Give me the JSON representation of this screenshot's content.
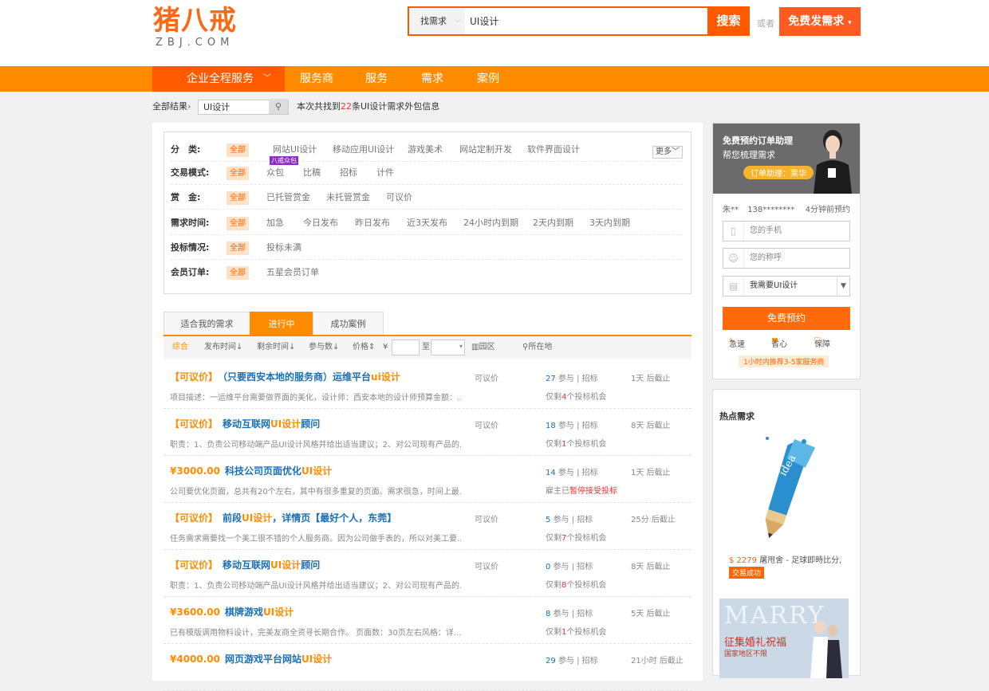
{
  "header": {
    "logo_cn": "猪八戒",
    "logo_en": "ZBJ.COM",
    "search_type": "找需求",
    "search_value": "UI设计",
    "search_btn": "搜索",
    "or": "或者",
    "post_btn": "免费发需求",
    "brand_color": "#ff5a00"
  },
  "nav": {
    "all_services": "企业全程服务",
    "items": [
      "服务商",
      "服务",
      "需求",
      "案例"
    ]
  },
  "crumb": {
    "all": "全部结果",
    "keyword": "UI设计",
    "found_pre": "本次共找到",
    "found_num": "22",
    "found_post": "条UI设计需求外包信息"
  },
  "filters": {
    "all_label": "全部",
    "more": "更多",
    "badge": "八戒众包",
    "rows": [
      {
        "label": "分　类:",
        "options": [
          "网站UI设计",
          "移动应用UI设计",
          "游戏美术",
          "网站定制开发",
          "软件界面设计"
        ]
      },
      {
        "label": "交易模式:",
        "options": [
          "众包",
          "比稿",
          "招标",
          "计件"
        ]
      },
      {
        "label": "赏　金:",
        "options": [
          "已托管赏金",
          "未托管赏金",
          "可议价"
        ]
      },
      {
        "label": "需求时间:",
        "options": [
          "加急",
          "今日发布",
          "昨日发布",
          "近3天发布",
          "24小时内到期",
          "2天内到期",
          "3天内到期"
        ]
      },
      {
        "label": "投标情况:",
        "options": [
          "投标未满"
        ]
      },
      {
        "label": "会员订单:",
        "options": [
          "五星会员订单"
        ]
      }
    ]
  },
  "tabs": [
    "适合我的需求",
    "进行中",
    "成功案例"
  ],
  "sortbar": {
    "items": [
      "综合",
      "发布时间",
      "剩余时间",
      "参与数",
      "价格"
    ],
    "currency": "¥",
    "to": "至",
    "region": "园区",
    "location": "所在地"
  },
  "rows": [
    {
      "price_tag": "【可议价】",
      "title_a": "（只要西安本地的服务商）运维平台",
      "title_hl": "ui设计",
      "title_b": "",
      "desc": "项目描述：一运维平台需要做界面的美化，设计师：西安本地的设计师预算金额：...",
      "price": "可议价",
      "count": "27",
      "part": " 参与 | 招标",
      "chance_pre": "仅剩",
      "chance_n": "4",
      "chance_post": "个投标机会",
      "dead": "1天 后截止"
    },
    {
      "price_tag": "【可议价】",
      "title_a": "移动互联网",
      "title_hl": "UI设计",
      "title_b": "顾问",
      "desc": "职责：1、负责公司移动端产品UI设计风格并给出适当建议；2、对公司现有产品的...",
      "price": "可议价",
      "count": "18",
      "part": " 参与 | 招标",
      "chance_pre": "仅剩",
      "chance_n": "1",
      "chance_post": "个投标机会",
      "dead": "8天 后截止"
    },
    {
      "price_tag": "¥3000.00",
      "title_a": "科技公司页面优化",
      "title_hl": "UI设计",
      "title_b": "",
      "desc": "公司要优化页面，总共有20个左右，其中有很多重复的页面。需求很急，时间上最...",
      "price": "",
      "count": "14",
      "part": " 参与 | 招标",
      "chance_pre": "雇主已",
      "chance_n": "",
      "chance_post": "暂停接受投标",
      "dead": "1天 后截止"
    },
    {
      "price_tag": "【可议价】",
      "title_a": "前段",
      "title_hl": "UI设计",
      "title_b": "，详情页【最好个人，东莞】",
      "desc": "任务需求需要找一个美工很不错的个人服务商。因为公司做手表的，所以对美工要...",
      "price": "可议价",
      "count": "5",
      "part": " 参与 | 招标",
      "chance_pre": "仅剩",
      "chance_n": "7",
      "chance_post": "个投标机会",
      "dead": "25分 后截止"
    },
    {
      "price_tag": "【可议价】",
      "title_a": "移动互联网",
      "title_hl": "UI设计",
      "title_b": "顾问",
      "desc": "职责：1、负责公司移动端产品UI设计风格并给出适当建议；2、对公司现有产品的...",
      "price": "可议价",
      "count": "0",
      "part": " 参与 | 招标",
      "chance_pre": "仅剩",
      "chance_n": "8",
      "chance_post": "个投标机会",
      "dead": "8天 后截止"
    },
    {
      "price_tag": "¥3600.00",
      "title_a": "棋牌游戏",
      "title_hl": "UI设计",
      "title_b": "",
      "desc": "已有模版调用物料设计，完美友商全资寻长期合作。 页面数：30页左右风格：详...",
      "price": "",
      "count": "8",
      "part": " 参与 | 招标",
      "chance_pre": "仅剩",
      "chance_n": "1",
      "chance_post": "个投标机会",
      "dead": "5天 后截止"
    },
    {
      "price_tag": "¥4000.00",
      "title_a": "网页游戏平台网站",
      "title_hl": "UI设计",
      "title_b": "",
      "desc": "",
      "price": "",
      "count": "29",
      "part": " 参与 | 招标",
      "chance_pre": "",
      "chance_n": "",
      "chance_post": "",
      "dead": "21小时 后截止"
    }
  ],
  "side": {
    "banner_t1": "免费预约订单助理",
    "banner_t2": "帮您梳理需求",
    "banner_pill": "订单助理：莱华",
    "latest_user": "朱**",
    "latest_phone": "138********",
    "latest_time": "4分钟前预约",
    "phone_ph": "您的手机",
    "name_ph": "您的称呼",
    "need_value": "我需要UI设计",
    "free_btn": "免费预约",
    "perks": [
      "急速",
      "省心",
      "保障"
    ],
    "recommend": "1小时内推荐3-5家服务商"
  },
  "hot": {
    "title": "热点需求",
    "cap_price": "$ 2279",
    "cap_text": "屠甩舍 - 足球即時比分,",
    "status": "交易成功",
    "poster_big": "MARRY",
    "poster_a": "征集婚礼祝福",
    "poster_b": "国家地区不限"
  }
}
